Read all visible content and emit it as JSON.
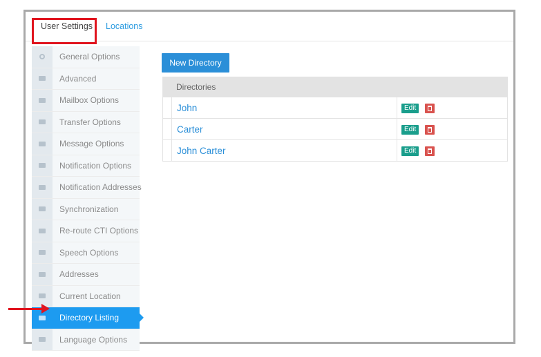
{
  "tabs": [
    {
      "label": "User Settings"
    },
    {
      "label": "Locations"
    }
  ],
  "sidebar": {
    "items": [
      {
        "label": "General Options",
        "icon": "gear-icon"
      },
      {
        "label": "Advanced",
        "icon": "envelope-icon"
      },
      {
        "label": "Mailbox Options",
        "icon": "envelope-icon"
      },
      {
        "label": "Transfer Options",
        "icon": "envelope-icon"
      },
      {
        "label": "Message Options",
        "icon": "envelope-icon"
      },
      {
        "label": "Notification Options",
        "icon": "envelope-icon"
      },
      {
        "label": "Notification Addresses",
        "icon": "envelope-icon"
      },
      {
        "label": "Synchronization",
        "icon": "envelope-icon"
      },
      {
        "label": "Re-route CTI Options",
        "icon": "envelope-icon"
      },
      {
        "label": "Speech Options",
        "icon": "envelope-icon"
      },
      {
        "label": "Addresses",
        "icon": "envelope-icon"
      },
      {
        "label": "Current Location",
        "icon": "envelope-icon"
      },
      {
        "label": "Directory Listing",
        "icon": "envelope-icon",
        "active": true
      },
      {
        "label": "Language Options",
        "icon": "envelope-icon"
      }
    ]
  },
  "main": {
    "new_button": "New Directory",
    "table_header": "Directories",
    "rows": [
      {
        "name": "John",
        "edit": "Edit"
      },
      {
        "name": "Carter",
        "edit": "Edit"
      },
      {
        "name": "John Carter",
        "edit": "Edit"
      }
    ]
  },
  "colors": {
    "accent": "#1d9bf0",
    "button": "#2b8fd8",
    "edit": "#1a9e8c",
    "delete": "#d9534f",
    "annotation": "#e0141e"
  }
}
